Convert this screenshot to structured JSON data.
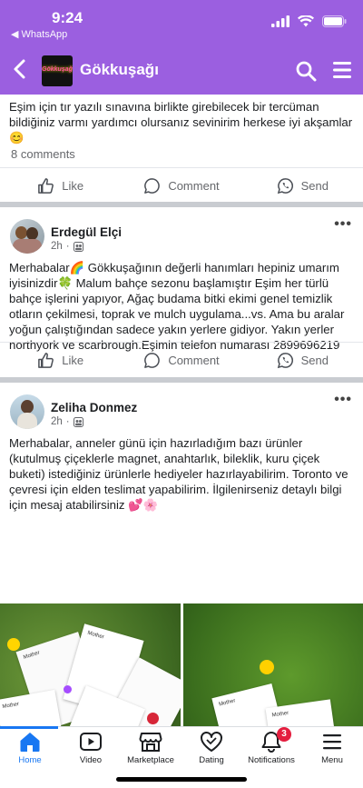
{
  "status_bar": {
    "time": "9:24",
    "back_app": "◀ WhatsApp"
  },
  "header": {
    "group_name": "Gökkuşağı",
    "logo_text": "Gökkuşağı"
  },
  "posts": [
    {
      "text": "Eşim için tır yazılı sınavına birlikte girebilecek bir tercüman bildiğiniz varmı yardımcı olursanız sevinirim herkese iyi akşamlar 😊",
      "comments": "8 comments"
    },
    {
      "author": "Erdegül Elçi",
      "time": "2h",
      "text": "Merhabalar🌈 Gökkuşağının değerli hanımları hepiniz umarım iyisinizdir🍀 Malum bahçe sezonu başlamıştır  Eşim her türlü bahçe işlerini yapıyor, Ağaç budama bitki ekimi genel temizlik otların çekilmesi, toprak ve mulch uygulama...vs. Ama bu aralar yoğun çalıştığından sadece yakın yerlere gidiyor. Yakın yerler northyork ve scarbrough.Eşimin telefon numarası  2899696219"
    },
    {
      "author": "Zeliha Donmez",
      "time": "2h",
      "text": "Merhabalar, anneler günü için hazırladığım bazı ürünler (kutulmuş çiçeklerle magnet, anahtarlık, bileklik, kuru çiçek buketi) istediğiniz ürünlerle hediyeler hazırlayabilirim. Toronto ve çevresi için elden teslimat yapabilirim. İlgilenirseniz detaylı bilgi için mesaj atabilirsiniz  💕🌸",
      "card_word": "Mother"
    }
  ],
  "actions": {
    "like": "Like",
    "comment": "Comment",
    "send": "Send"
  },
  "tabs": {
    "home": "Home",
    "video": "Video",
    "marketplace": "Marketplace",
    "dating": "Dating",
    "notifications": "Notifications",
    "menu": "Menu",
    "notifications_badge": "3"
  },
  "colors": {
    "brand_purple": "#9b5fe0",
    "fb_blue": "#1877f2",
    "badge_red": "#e41e3f"
  }
}
